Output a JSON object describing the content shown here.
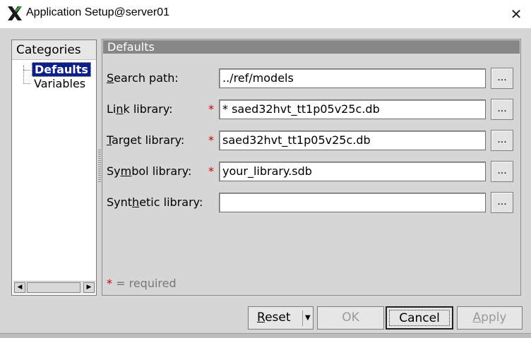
{
  "window": {
    "title": "Application Setup@server01",
    "close_label": "✕",
    "app_icon": "x-logo-icon"
  },
  "categories": {
    "header": "Categories",
    "items": [
      {
        "label": "Defaults",
        "selected": true
      },
      {
        "label": "Variables",
        "selected": false
      }
    ],
    "scroll_left": "◀",
    "scroll_right": "▶"
  },
  "panel": {
    "header": "Defaults",
    "browse_label": "...",
    "fields": [
      {
        "pre": "",
        "u": "S",
        "post": "earch path:",
        "value": "../ref/models",
        "required": false
      },
      {
        "pre": "Li",
        "u": "n",
        "post": "k library:",
        "value": "* saed32hvt_tt1p05v25c.db",
        "required": true
      },
      {
        "pre": "",
        "u": "T",
        "post": "arget library:",
        "value": "saed32hvt_tt1p05v25c.db",
        "required": true
      },
      {
        "pre": "Sy",
        "u": "m",
        "post": "bol library:",
        "value": "your_library.sdb",
        "required": true
      },
      {
        "pre": "Synt",
        "u": "h",
        "post": "etic library:",
        "value": "",
        "required": false
      }
    ],
    "required_mark": "*",
    "required_note": "= required"
  },
  "buttons": {
    "reset": {
      "u": "R",
      "rest": "eset"
    },
    "reset_arrow": "▼",
    "ok": "OK",
    "cancel": "Cancel",
    "apply": {
      "u": "A",
      "rest": "pply"
    }
  }
}
